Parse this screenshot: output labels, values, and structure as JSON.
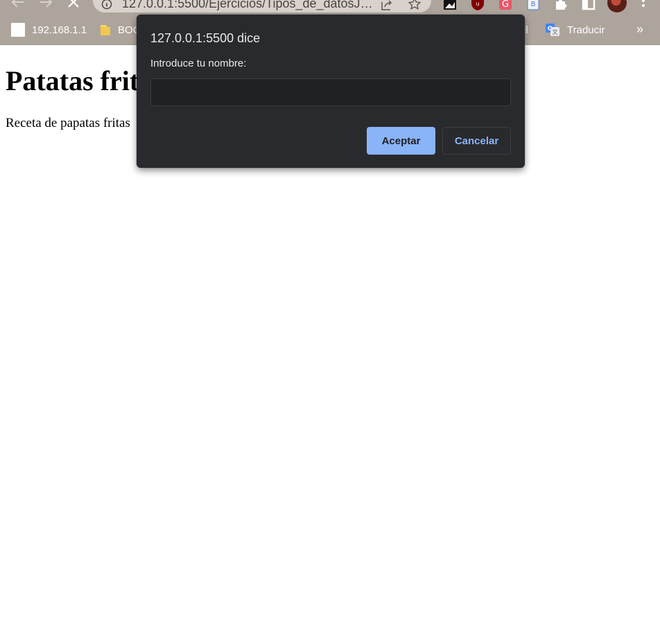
{
  "browser": {
    "address_bar": {
      "url": "127.0.0.1:5500/Ejercicios/Tipos_de_datosJS/P..."
    },
    "bookmarks": [
      {
        "label": "192.168.1.1",
        "icon": "page-icon"
      },
      {
        "label": "BOC",
        "icon": "folder-icon"
      },
      {
        "label": "il",
        "icon": "none"
      },
      {
        "label": "Traducir",
        "icon": "google-translate-icon"
      }
    ],
    "bookmarks_overflow": "»"
  },
  "page": {
    "heading": "Patatas frit",
    "paragraph": "Receta de papatas fritas"
  },
  "dialog": {
    "title": "127.0.0.1:5500 dice",
    "message": "Introduce tu nombre:",
    "input_value": "",
    "ok_label": "Aceptar",
    "cancel_label": "Cancelar"
  },
  "colors": {
    "chrome_bg": "#ada49c",
    "dialog_bg": "#292a2d",
    "accent": "#8ab4f8"
  }
}
